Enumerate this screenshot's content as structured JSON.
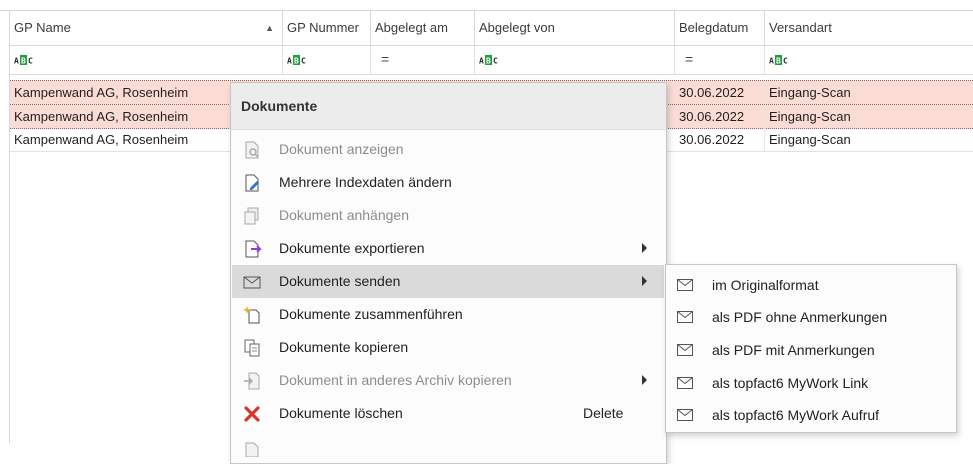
{
  "grid": {
    "columns": [
      {
        "label": "GP Name"
      },
      {
        "label": "GP Nummer"
      },
      {
        "label": "Abgelegt am"
      },
      {
        "label": "Abgelegt von"
      },
      {
        "label": "Belegdatum"
      },
      {
        "label": "Versandart"
      }
    ],
    "sort_indicator": "▲",
    "filter_icons": [
      "abc-text-filter-icon",
      "abc-text-filter-icon",
      "equals-filter-icon",
      "abc-text-filter-icon",
      "equals-filter-icon",
      "abc-text-filter-icon"
    ],
    "filter_equals": "=",
    "rows": [
      {
        "gp_name": "Kampenwand AG, Rosenheim",
        "belegdatum": "30.06.2022",
        "versandart": "Eingang-Scan",
        "selected": true
      },
      {
        "gp_name": "Kampenwand AG, Rosenheim",
        "belegdatum": "30.06.2022",
        "versandart": "Eingang-Scan",
        "selected": true
      },
      {
        "gp_name": "Kampenwand AG, Rosenheim",
        "belegdatum": "30.06.2022",
        "versandart": "Eingang-Scan",
        "selected": false
      }
    ],
    "selected_row_color": "#fbdcd5"
  },
  "context_menu": {
    "title": "Dokumente",
    "items": [
      {
        "label": "Dokument anzeigen",
        "icon": "document-view-icon",
        "disabled": true
      },
      {
        "label": "Mehrere Indexdaten ändern",
        "icon": "document-edit-icon",
        "disabled": false
      },
      {
        "label": "Dokument anhängen",
        "icon": "document-attach-icon",
        "disabled": true
      },
      {
        "label": "Dokumente exportieren",
        "icon": "document-export-icon",
        "disabled": false,
        "submenu": true
      },
      {
        "label": "Dokumente senden",
        "icon": "envelope-icon",
        "disabled": false,
        "submenu": true,
        "highlighted": true
      },
      {
        "label": "Dokumente zusammenführen",
        "icon": "document-merge-icon",
        "disabled": false
      },
      {
        "label": "Dokumente kopieren",
        "icon": "document-copy-icon",
        "disabled": false
      },
      {
        "label": "Dokument in anderes Archiv kopieren",
        "icon": "archive-copy-icon",
        "disabled": true,
        "submenu": true
      },
      {
        "label": "Dokumente löschen",
        "icon": "delete-x-icon",
        "disabled": false,
        "shortcut": "Delete"
      }
    ],
    "highlight_color": "#dadada",
    "delete_icon_color": "#d9342b",
    "export_arrow_color": "#8e3fd0"
  },
  "send_submenu": {
    "items": [
      {
        "label": "im Originalformat",
        "icon": "envelope-icon"
      },
      {
        "label": "als PDF ohne Anmerkungen",
        "icon": "envelope-icon"
      },
      {
        "label": "als PDF mit Anmerkungen",
        "icon": "envelope-icon"
      },
      {
        "label": "als topfact6 MyWork Link",
        "icon": "envelope-icon"
      },
      {
        "label": "als topfact6 MyWork Aufruf",
        "icon": "envelope-icon"
      }
    ]
  }
}
